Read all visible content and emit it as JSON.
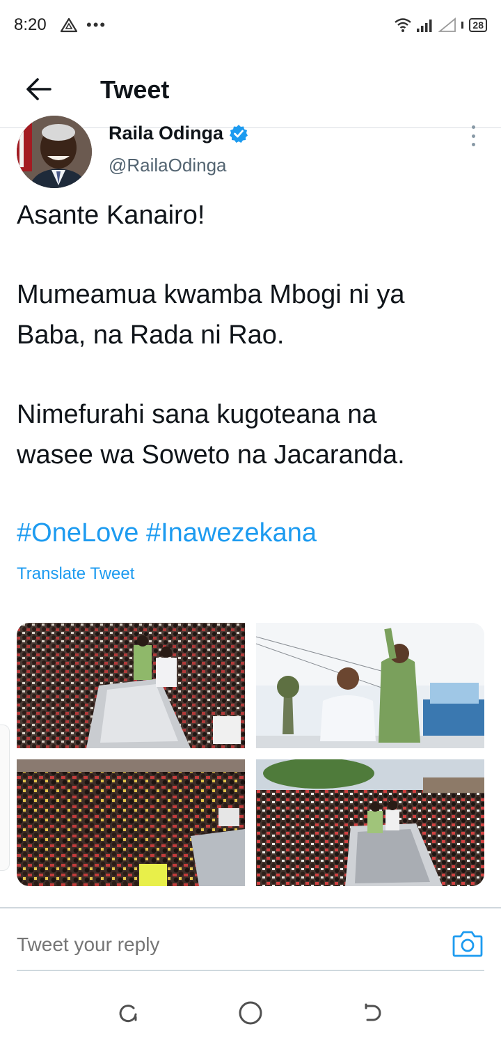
{
  "status_bar": {
    "time": "8:20",
    "dots": "•••",
    "battery": "28"
  },
  "header": {
    "title": "Tweet",
    "back_icon": "arrow-left-icon"
  },
  "tweet": {
    "author_name": "Raila Odinga",
    "handle": "@RailaOdinga",
    "verified": true,
    "lines": [
      "Asante Kanairo!",
      "Mumeamua kwamba Mbogi ni ya",
      "Baba, na Rada ni Rao.",
      "Nimefurahi sana kugoteana na",
      "wasee wa Soweto na Jacaranda."
    ],
    "hashtags": [
      "#OneLove",
      "#Inawezekana"
    ],
    "translate_label": "Translate Tweet"
  },
  "reply": {
    "placeholder": "Tweet your reply"
  },
  "colors": {
    "link": "#1d9bf0",
    "text": "#0f1419",
    "secondary": "#536471"
  }
}
